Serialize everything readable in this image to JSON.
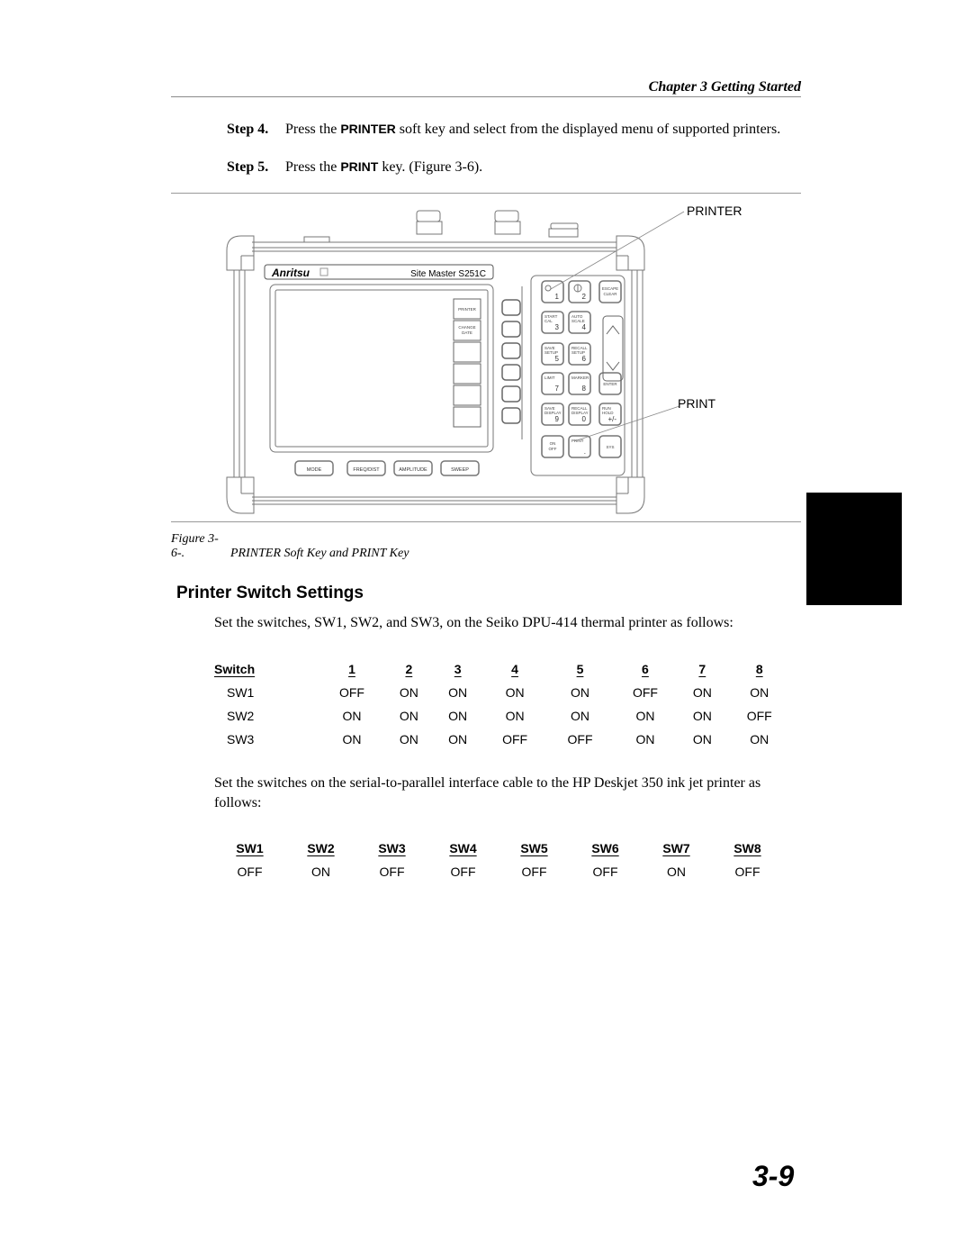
{
  "header": {
    "running_head": "Chapter 3 Getting Started"
  },
  "steps": [
    {
      "num": "Step 4.",
      "pre": "Press the ",
      "key": "PRINTER",
      "post": " soft key and select from the displayed menu of supported printers."
    },
    {
      "num": "Step 5.",
      "pre": "Press the ",
      "key": "PRINT",
      "post": " key.  (Figure 3-6)."
    }
  ],
  "figure": {
    "callout_printer": "PRINTER",
    "callout_print": "PRINT",
    "device": {
      "brand": "Anritsu",
      "model": "Site Master S251C",
      "screen_softkeys": [
        "PRINTER",
        "CHANGE DATE",
        "",
        "",
        "",
        ""
      ],
      "bottom_keys": [
        "MODE",
        "FREQ/DIST",
        "AMPLITUDE",
        "SWEEP"
      ],
      "keypad": [
        {
          "label": "",
          "digit": "1",
          "icon": "light-icon"
        },
        {
          "label": "",
          "digit": "2",
          "icon": "contrast-icon"
        },
        {
          "label": "ESCAPE CLEAR",
          "digit": ""
        },
        {
          "label": "START CAL",
          "digit": "3"
        },
        {
          "label": "AUTO SCALE",
          "digit": "4"
        },
        {
          "label": "SAVE SETUP",
          "digit": "5"
        },
        {
          "label": "RECALL SETUP",
          "digit": "6"
        },
        {
          "label": "LIMIT",
          "digit": "7"
        },
        {
          "label": "MARKER",
          "digit": "8"
        },
        {
          "label": "ENTER",
          "digit": ""
        },
        {
          "label": "SAVE DISPLAY",
          "digit": "9"
        },
        {
          "label": "RECALL DISPLAY",
          "digit": "0"
        },
        {
          "label": "RUN HOLD",
          "digit": "+/-"
        },
        {
          "label": "ON OFF",
          "digit": ""
        },
        {
          "label": "PRINT",
          "digit": "."
        },
        {
          "label": "SYS",
          "digit": ""
        }
      ]
    },
    "caption_num": "Figure 3-6-.",
    "caption_text": "PRINTER Soft Key and PRINT Key"
  },
  "section": {
    "title": "Printer Switch Settings",
    "intro": "Set the switches, SW1, SW2, and SW3, on the Seiko DPU-414 thermal printer as follows:",
    "seiko_table": {
      "headers": [
        "Switch",
        "1",
        "2",
        "3",
        "4",
        "5",
        "6",
        "7",
        "8"
      ],
      "rows": [
        [
          "SW1",
          "OFF",
          "ON",
          "ON",
          "ON",
          "ON",
          "OFF",
          "ON",
          "ON"
        ],
        [
          "SW2",
          "ON",
          "ON",
          "ON",
          "ON",
          "ON",
          "ON",
          "ON",
          "OFF"
        ],
        [
          "SW3",
          "ON",
          "ON",
          "ON",
          "OFF",
          "OFF",
          "ON",
          "ON",
          "ON"
        ]
      ]
    },
    "hp_intro": "Set the switches on the serial-to-parallel interface cable to the HP Deskjet 350 ink jet printer as follows:",
    "hp_table": {
      "headers": [
        "SW1",
        "SW2",
        "SW3",
        "SW4",
        "SW5",
        "SW6",
        "SW7",
        "SW8"
      ],
      "values": [
        "OFF",
        "ON",
        "OFF",
        "OFF",
        "OFF",
        "OFF",
        "ON",
        "OFF"
      ]
    }
  },
  "footer": {
    "page_number": "3-9"
  }
}
